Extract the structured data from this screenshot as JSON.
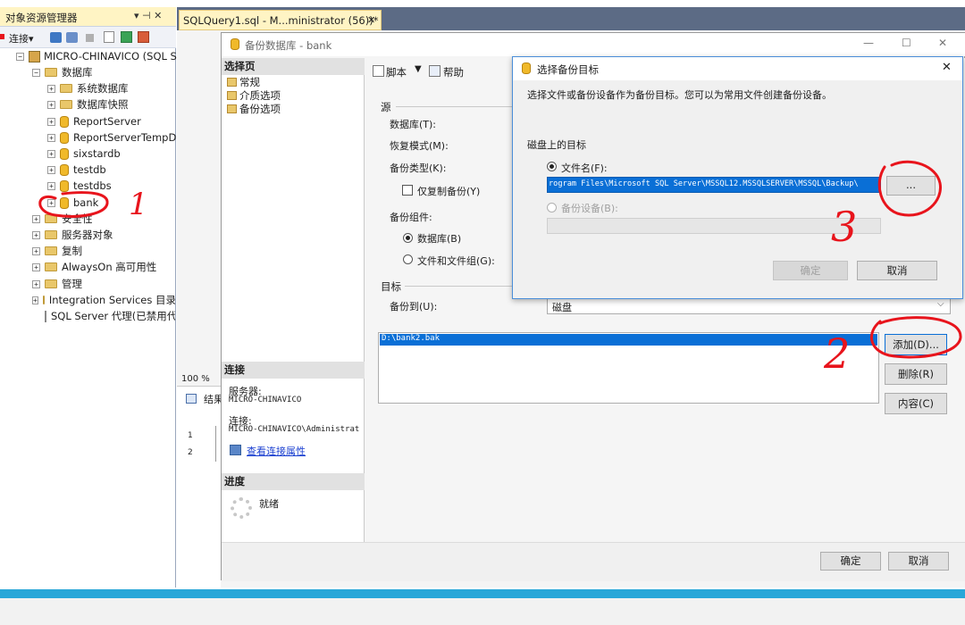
{
  "object_explorer": {
    "title": "对象资源管理器",
    "pin_glyphs": "▾ ⊣ ✕",
    "connect_label": "连接▾",
    "server": "MICRO-CHINAVICO (SQL S",
    "databases_label": "数据库",
    "tree": [
      {
        "label": "系统数据库",
        "kind": "folder"
      },
      {
        "label": "数据库快照",
        "kind": "folder"
      },
      {
        "label": "ReportServer",
        "kind": "db"
      },
      {
        "label": "ReportServerTempD",
        "kind": "db"
      },
      {
        "label": "sixstardb",
        "kind": "db"
      },
      {
        "label": "testdb",
        "kind": "db"
      },
      {
        "label": "testdbs",
        "kind": "db"
      },
      {
        "label": "bank",
        "kind": "db"
      }
    ],
    "top_nodes": [
      "安全性",
      "服务器对象",
      "复制",
      "AlwaysOn 高可用性",
      "管理",
      "Integration Services 目录"
    ],
    "agent": "SQL Server 代理(已禁用代"
  },
  "editor_tab": {
    "label": "SQLQuery1.sql - M...ministrator (56))*",
    "close": "✕"
  },
  "editor": {
    "zoom": "100 %",
    "results_tab": "结果",
    "row_numbers": [
      "1",
      "2"
    ]
  },
  "backup_dialog": {
    "title": "备份数据库 - bank",
    "win_controls": [
      "—",
      "☐",
      "✕"
    ],
    "select_page_header": "选择页",
    "pages": [
      "常规",
      "介质选项",
      "备份选项"
    ],
    "script_label": "脚本",
    "help_label": "帮助",
    "source_section": "源",
    "database_label": "数据库(T):",
    "recovery_label": "恢复模式(M):",
    "backup_type_label": "备份类型(K):",
    "copy_only_label": "仅复制备份(Y)",
    "component_label": "备份组件:",
    "component_db": "数据库(B)",
    "component_files": "文件和文件组(G):",
    "target_section": "目标",
    "backup_to_label": "备份到(U):",
    "backup_to_value": "磁盘",
    "path_item": "D:\\bank2.bak",
    "add_button": "添加(D)...",
    "remove_button": "删除(R)",
    "contents_button": "内容(C)",
    "connection_header": "连接",
    "server_label": "服务器:",
    "server_value": "MICRO-CHINAVICO",
    "connection_label": "连接:",
    "connection_value": "MICRO-CHINAVICO\\Administrat",
    "view_props_link": "查看连接属性",
    "progress_header": "进度",
    "progress_status": "就绪",
    "ok_button": "确定",
    "cancel_button": "取消"
  },
  "select_target_dialog": {
    "title": "选择备份目标",
    "close": "✕",
    "description": "选择文件或备份设备作为备份目标。您可以为常用文件创建备份设备。",
    "disk_target_label": "磁盘上的目标",
    "file_name_option": "文件名(F):",
    "file_path": "rogram Files\\Microsoft SQL Server\\MSSQL12.MSSQLSERVER\\MSSQL\\Backup\\",
    "browse_button": "...",
    "device_option": "备份设备(B):",
    "ok_button": "确定",
    "cancel_button": "取消"
  },
  "annotations": {
    "step1": "1",
    "step2": "2",
    "step3": "3",
    "ink_color": "#e8141c"
  }
}
